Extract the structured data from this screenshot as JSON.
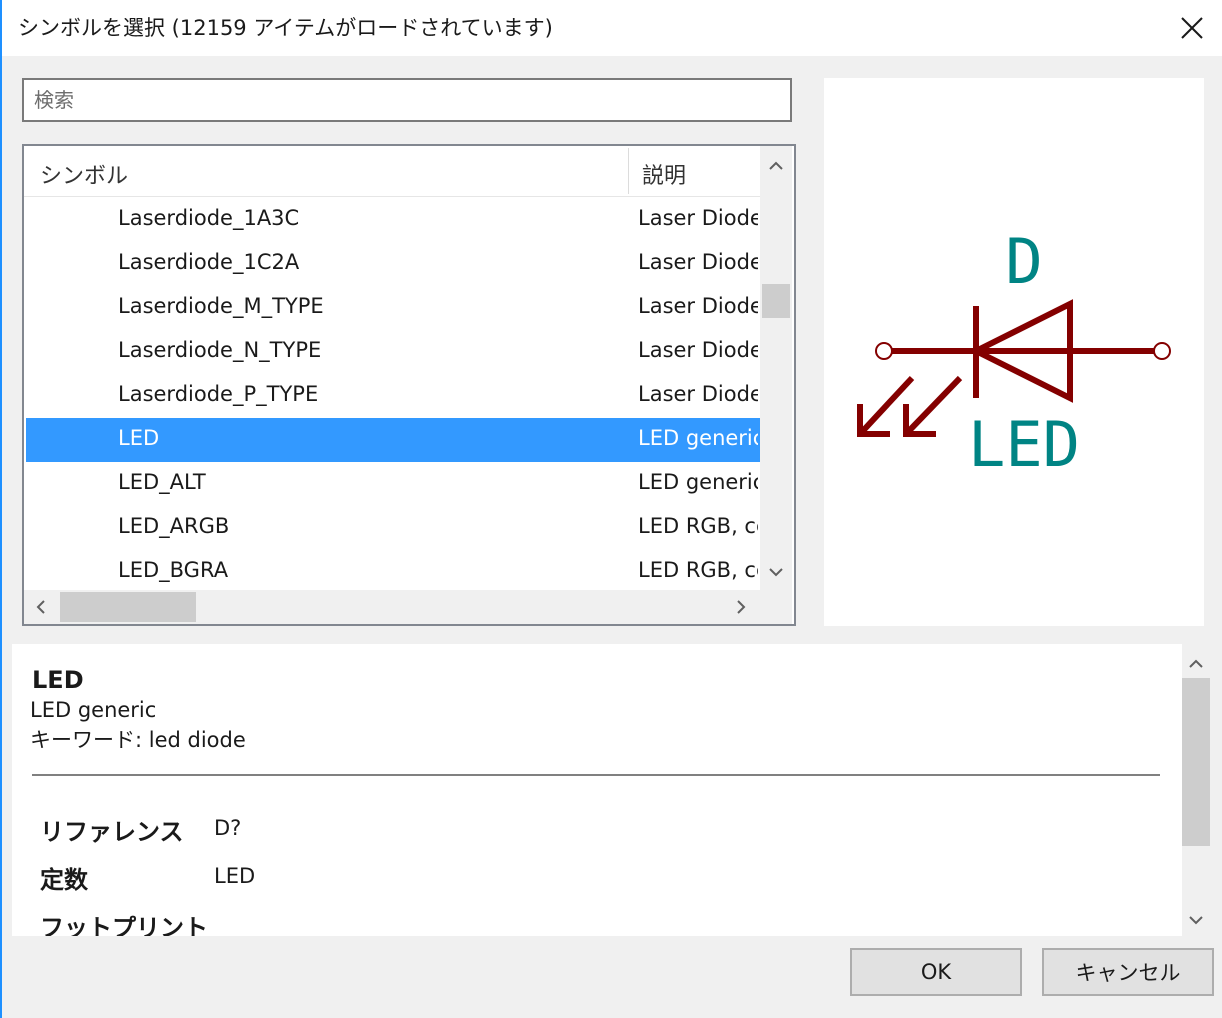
{
  "window": {
    "title": "シンボルを選択 (12159 アイテムがロードされています)",
    "close_icon": "close-icon"
  },
  "search": {
    "placeholder": "検索",
    "value": ""
  },
  "list": {
    "columns": {
      "symbol": "シンボル",
      "description": "説明"
    },
    "rows": [
      {
        "name": "Laserdiode_1A3C",
        "description": "Laser Diode",
        "selected": false
      },
      {
        "name": "Laserdiode_1C2A",
        "description": "Laser Diode",
        "selected": false
      },
      {
        "name": "Laserdiode_M_TYPE",
        "description": "Laser Diode",
        "selected": false
      },
      {
        "name": "Laserdiode_N_TYPE",
        "description": "Laser Diode",
        "selected": false
      },
      {
        "name": "Laserdiode_P_TYPE",
        "description": "Laser Diode",
        "selected": false
      },
      {
        "name": "LED",
        "description": "LED generic",
        "selected": true
      },
      {
        "name": "LED_ALT",
        "description": "LED generic",
        "selected": false
      },
      {
        "name": "LED_ARGB",
        "description": "LED RGB, cc",
        "selected": false
      },
      {
        "name": "LED_BGRA",
        "description": "LED RGB, cc",
        "selected": false
      }
    ],
    "selection_color": "#3399ff"
  },
  "preview": {
    "reference": "D",
    "value": "LED",
    "body_color": "#840000",
    "text_color": "#008484"
  },
  "details": {
    "name": "LED",
    "description": "LED generic",
    "keywords": "キーワード: led diode",
    "fields": [
      {
        "label": "リファレンス",
        "value": "D?"
      },
      {
        "label": "定数",
        "value": "LED"
      },
      {
        "label": "フットプリント",
        "value": ""
      }
    ]
  },
  "buttons": {
    "ok": "OK",
    "cancel": "キャンセル"
  }
}
